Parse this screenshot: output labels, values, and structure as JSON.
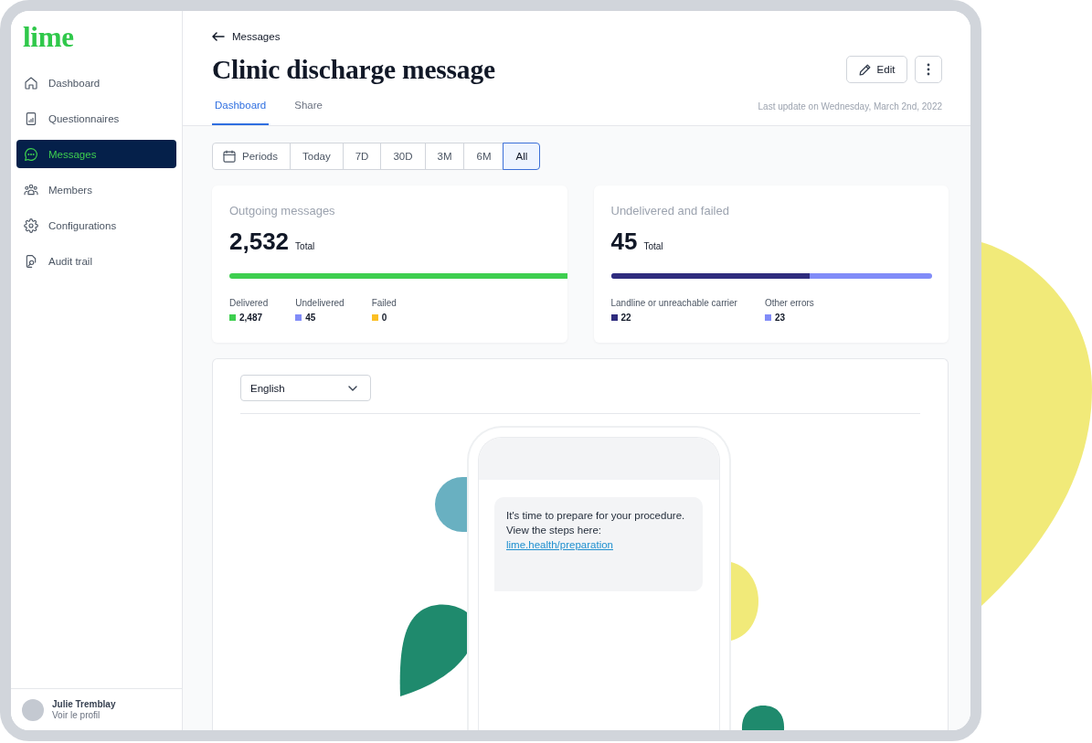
{
  "sidebar": {
    "logo": "lime",
    "items": [
      {
        "label": "Dashboard",
        "selected": false
      },
      {
        "label": "Questionnaires",
        "selected": false
      },
      {
        "label": "Messages",
        "selected": true
      },
      {
        "label": "Members",
        "selected": false
      },
      {
        "label": "Configurations",
        "selected": false
      },
      {
        "label": "Audit trail",
        "selected": false
      }
    ],
    "profile": {
      "name": "Julie Tremblay",
      "link": "Voir le profil"
    }
  },
  "header": {
    "back_link": "Messages",
    "title": "Clinic discharge message",
    "edit_button": "Edit",
    "tabs": [
      {
        "label": "Dashboard",
        "selected": true
      },
      {
        "label": "Share",
        "selected": false
      }
    ],
    "last_update": "Last update on Wednesday, March 2nd, 2022"
  },
  "filters": {
    "periods_button": "Periods",
    "ranges": [
      {
        "label": "Today",
        "selected": false
      },
      {
        "label": "7D",
        "selected": false
      },
      {
        "label": "30D",
        "selected": false
      },
      {
        "label": "3M",
        "selected": false
      },
      {
        "label": "6M",
        "selected": false
      },
      {
        "label": "All",
        "selected": true
      }
    ]
  },
  "cards": [
    {
      "title": "Outgoing messages",
      "total": "2,532",
      "total_label": "Total",
      "bar": {
        "level": 1
      },
      "legend": [
        {
          "label": "Delivered",
          "value": "2,487",
          "color": "#3ecf4f"
        },
        {
          "label": "Undelivered",
          "value": "45",
          "color": "#818cf8"
        },
        {
          "label": "Failed",
          "value": "0",
          "color": "#fbbf24"
        }
      ]
    },
    {
      "title": "Undelivered and failed",
      "total": "45",
      "total_label": "Total",
      "bar": {
        "level": 0.62
      },
      "legend": [
        {
          "label": "Landline or unreachable carrier",
          "value": "22",
          "color": "#2f2c7e"
        },
        {
          "label": "Other errors",
          "value": "23",
          "color": "#818cf8"
        }
      ]
    }
  ],
  "preview": {
    "language": "English",
    "message": {
      "text": "It's time to prepare for your procedure.\nView the steps here:",
      "link": "lime.health/preparation"
    }
  }
}
